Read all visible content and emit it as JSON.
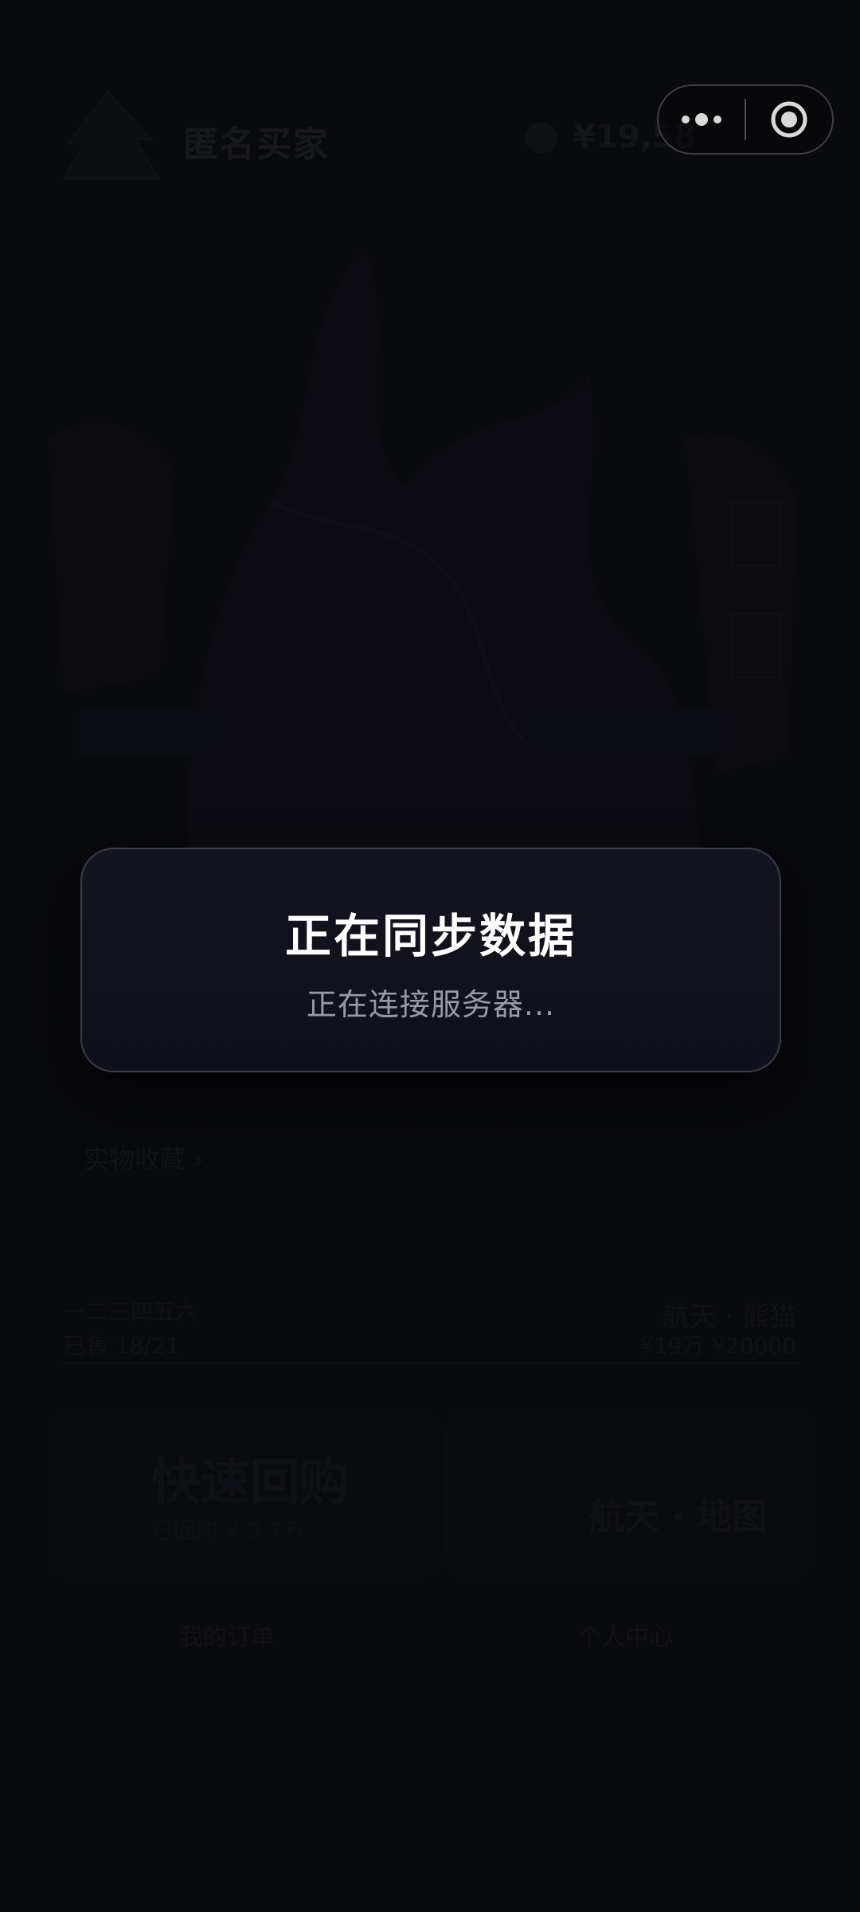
{
  "background": {
    "header": {
      "username": "匿名买家",
      "balance": "¥19,58"
    },
    "section_select": "实物收藏 ›",
    "table": {
      "left_top": "一二三四五六",
      "left_bottom": "已售 18/21",
      "right_top": "航天 · 熊猫",
      "right_bottom": "¥19万 ¥20000"
    },
    "cards": {
      "left_title": "快速回购",
      "left_sub": "已回购 ¥ 3.7万",
      "right_title": "航天 · 地图"
    },
    "bottom_tabs": [
      "我的订单",
      "个人中心"
    ]
  },
  "capsule": {
    "more_icon": "more-dots-icon",
    "close_icon": "target-close-icon"
  },
  "modal": {
    "title": "正在同步数据",
    "subtitle": "正在连接服务器..."
  },
  "colors": {
    "page_background": "#0b0c10",
    "modal_background": "#12121c",
    "modal_border": "#3a3b45",
    "title": "#ffffff",
    "subtitle": "#9a9aa6"
  }
}
